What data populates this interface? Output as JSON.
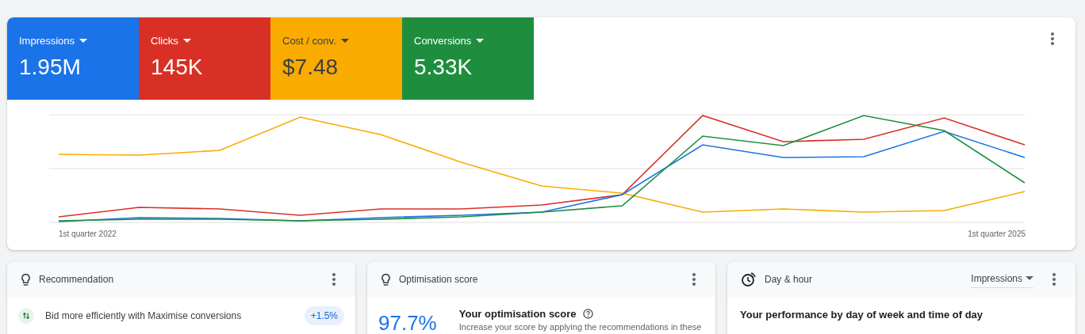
{
  "metrics": [
    {
      "label": "Impressions",
      "value": "1.95M",
      "color": "#1a73e8",
      "dark_text": false
    },
    {
      "label": "Clicks",
      "value": "145K",
      "color": "#d93025",
      "dark_text": false
    },
    {
      "label": "Cost / conv.",
      "value": "$7.48",
      "color": "#f9ab00",
      "dark_text": true
    },
    {
      "label": "Conversions",
      "value": "5.33K",
      "color": "#1e8e3e",
      "dark_text": false
    }
  ],
  "chart": {
    "x_start_label": "1st quarter 2022",
    "x_end_label": "1st quarter 2025"
  },
  "cards": [
    {
      "kind": "recommendation",
      "title": "Recommendation",
      "text": "Bid more efficiently with Maximise conversions",
      "badge": "+1.5%"
    },
    {
      "kind": "score",
      "title": "Optimisation score",
      "score": "97.7%",
      "heading": "Your optimisation score",
      "text": "Increase your score by applying the recommendations in these"
    },
    {
      "kind": "dayhour",
      "title": "Day & hour",
      "dropdown": "Impressions",
      "heading": "Your performance by day of week and time of day"
    }
  ]
}
